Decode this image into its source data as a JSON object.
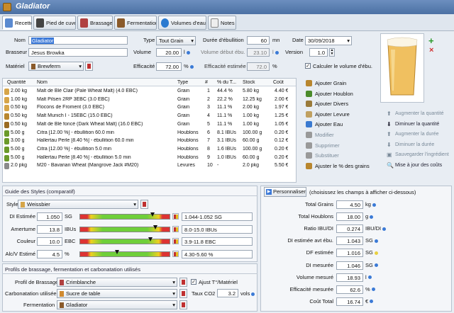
{
  "window": {
    "title": "Gladiator"
  },
  "tabs": [
    {
      "label": "Recette",
      "color": "#5a8ad0"
    },
    {
      "label": "Pied de cuve",
      "color": "#444"
    },
    {
      "label": "Brassage",
      "color": "#b04040"
    },
    {
      "label": "Fermentation",
      "color": "#8a5a2a"
    },
    {
      "label": "Volumes d'eau",
      "color": "#2a7ad0"
    },
    {
      "label": "Notes",
      "color": "#6a6a6a"
    }
  ],
  "form": {
    "nom_label": "Nom",
    "nom_value": "Gladiator",
    "type_label": "Type",
    "type_value": "Tout Grain",
    "duree_label": "Durée d'ébullition",
    "duree_value": "60",
    "duree_unit": "mn",
    "date_label": "Date",
    "date_value": "30/09/2018",
    "brasseur_label": "Brasseur",
    "brasseur_value": "Jesus Browka",
    "volume_label": "Volume",
    "volume_value": "20.00",
    "volume_unit": "l",
    "vol_debut_label": "Volume début ébu.",
    "vol_debut_value": "23.10",
    "vol_debut_unit": "l",
    "version_label": "Version",
    "version_value": "1.0",
    "materiel_label": "Matériel",
    "materiel_value": "Brewferm",
    "efficacite_label": "Efficacité",
    "efficacite_value": "72.00",
    "efficacite_unit": "%",
    "eff_estimee_label": "Efficacité estimée",
    "eff_estimee_value": "72.0",
    "eff_estimee_unit": "%",
    "calc_volume_label": "Calculer le volume d'ébu.",
    "calc_volume_checked": "✓"
  },
  "grid": {
    "headers": [
      "Quantité",
      "Nom",
      "Type",
      "#",
      "% du T...",
      "Stock",
      "Coût"
    ],
    "rows": [
      {
        "qty": "2.00 kg",
        "name": "Malt de Blé Clair (Pale Wheat Malt) (4.0 EBC)",
        "type": "Grain",
        "num": "1",
        "pct": "44.4 %",
        "stock": "5.80 kg",
        "cost": "4.40 €",
        "icon": "#d6a548"
      },
      {
        "qty": "1.00 kg",
        "name": "Malt Pilsen 2RP 3EBC (3.0 EBC)",
        "type": "Grain",
        "num": "2",
        "pct": "22.2 %",
        "stock": "12.25 kg",
        "cost": "2.00 €",
        "icon": "#d6a548"
      },
      {
        "qty": "0.50 kg",
        "name": "Flocons de Froment (3.0 EBC)",
        "type": "Grain",
        "num": "3",
        "pct": "11.1 %",
        "stock": "2.00 kg",
        "cost": "1.97 €",
        "icon": "#d6a548"
      },
      {
        "qty": "0.50 kg",
        "name": "Malt Munich I - 15EBC (15.0 EBC)",
        "type": "Grain",
        "num": "4",
        "pct": "11.1 %",
        "stock": "1.00 kg",
        "cost": "1.25 €",
        "icon": "#b8862e"
      },
      {
        "qty": "0.50 kg",
        "name": "Malt de Blé foncé (Dark Wheat Malt) (16.0 EBC)",
        "type": "Grain",
        "num": "5",
        "pct": "11.1 %",
        "stock": "1.00 kg",
        "cost": "1.05 €",
        "icon": "#9a6a22"
      },
      {
        "qty": "5.00 g",
        "name": "Citra [12.00 %] - ébullition 60.0 min",
        "type": "Houblons",
        "num": "6",
        "pct": "8.1 IBUs",
        "stock": "100.00 g",
        "cost": "0.20 €",
        "icon": "#6a9a2a"
      },
      {
        "qty": "3.00 g",
        "name": "Hallertau Perle [8.40 %] - ébullition 60.0 min",
        "type": "Houblons",
        "num": "7",
        "pct": "3.1 IBUs",
        "stock": "60.00 g",
        "cost": "0.12 €",
        "icon": "#6a9a2a"
      },
      {
        "qty": "5.00 g",
        "name": "Citra [12.00 %] - ébullition 5.0 min",
        "type": "Houblons",
        "num": "8",
        "pct": "1.6 IBUs",
        "stock": "100.00 g",
        "cost": "0.20 €",
        "icon": "#6a9a2a"
      },
      {
        "qty": "5.00 g",
        "name": "Hallertau Perle [8.40 %] - ébullition 5.0 min",
        "type": "Houblons",
        "num": "9",
        "pct": "1.0 IBUs",
        "stock": "60.00 g",
        "cost": "0.20 €",
        "icon": "#6a9a2a"
      },
      {
        "qty": "2.0 pkg",
        "name": "M20 - Bavarian Wheat (Mangrove Jack #M20)",
        "type": "Levures",
        "num": "10",
        "pct": "-",
        "stock": "2.0 pkg",
        "cost": "5.50 €",
        "icon": "#8a8a8a"
      }
    ]
  },
  "actions": [
    {
      "label": "Ajouter Grain",
      "enabled": true,
      "color": "#b8862e"
    },
    {
      "label": "Ajouter Houblon",
      "enabled": true,
      "color": "#4a8a2a"
    },
    {
      "label": "Ajouter Divers",
      "enabled": true,
      "color": "#9a7a3a"
    },
    {
      "label": "Ajouter Levure",
      "enabled": true,
      "color": "#c0a060"
    },
    {
      "label": "Ajouter Eau",
      "enabled": true,
      "color": "#3a7ad0"
    },
    {
      "label": "Modifier",
      "enabled": false,
      "color": "#999"
    },
    {
      "label": "Supprimer",
      "enabled": false,
      "color": "#999"
    },
    {
      "label": "Substituer",
      "enabled": false,
      "color": "#999"
    },
    {
      "label": "Ajuster le % des grains",
      "enabled": true,
      "color": "#b8862e"
    }
  ],
  "right_actions": [
    {
      "label": "Augmenter la quantité",
      "enabled": false
    },
    {
      "label": "Diminuer la quantité",
      "enabled": true
    },
    {
      "label": "Augmenter la durée",
      "enabled": false
    },
    {
      "label": "Diminuer la durée",
      "enabled": false
    },
    {
      "label": "Sauvegarder l'ingrédient",
      "enabled": false
    },
    {
      "label": "Mise à jour des coûts",
      "enabled": true
    }
  ],
  "styles": {
    "section_title": "Guide des Styles (comparatif)",
    "style_label": "Style",
    "style_value": "Weissbier",
    "rows": [
      {
        "label": "DI Estimée",
        "value": "1.050",
        "unit": "SG",
        "range": "1.044-1.052 SG",
        "marker": 0.75
      },
      {
        "label": "Amertume",
        "value": "13.8",
        "unit": "IBUs",
        "range": "8.0-15.0 IBUs",
        "marker": 0.78
      },
      {
        "label": "Couleur",
        "value": "10.0",
        "unit": "EBC",
        "range": "3.9-11.8 EBC",
        "marker": 0.73
      },
      {
        "label": "Alc/V Estimé",
        "value": "4.5",
        "unit": "%",
        "range": "4.30-5.60 %",
        "marker": 0.38
      }
    ]
  },
  "profiles": {
    "section_title": "Profils de brassage, fermentation et carbonatation utilisés",
    "brassage_label": "Profil de Brassage",
    "brassage_value": "Crimblanche",
    "ajust_label": "Ajust T°/Matériel",
    "ajust_checked": "✓",
    "carbo_label": "Carbonatation utilisée",
    "carbo_value": "Sucre de table",
    "taux_label": "Taux CO2",
    "taux_value": "3.2",
    "taux_unit": "vols",
    "ferm_label": "Fermentation",
    "ferm_value": "Gladiator"
  },
  "stats": {
    "personnaliser_label": "Personnaliser",
    "hint": "(choisissez les champs à afficher ci-dessous)",
    "rows": [
      {
        "label": "Total Grains",
        "value": "4.50",
        "unit": "kg"
      },
      {
        "label": "Total Houblons",
        "value": "18.00",
        "unit": "g"
      },
      {
        "label": "Ratio IBU/DI",
        "value": "0.274",
        "unit": "IBU/DI"
      },
      {
        "label": "DI estimée avt ébu.",
        "value": "1.043",
        "unit": "SG"
      },
      {
        "label": "DF estimée",
        "value": "1.016",
        "unit": "SG"
      },
      {
        "label": "DI mesurée",
        "value": "1.046",
        "unit": "SG"
      },
      {
        "label": "Volume mesuré",
        "value": "18.93",
        "unit": "l"
      },
      {
        "label": "Efficacité mesurée",
        "value": "62.6",
        "unit": "%"
      },
      {
        "label": "Coût Total",
        "value": "16.74",
        "unit": "€"
      }
    ]
  }
}
